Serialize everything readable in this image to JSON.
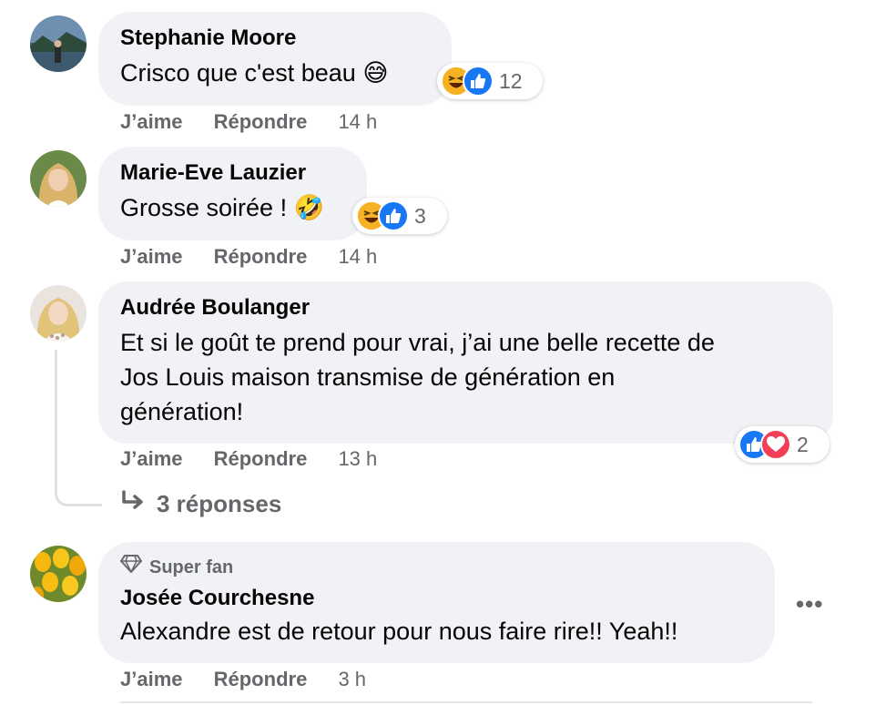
{
  "comments": [
    {
      "author": "Stephanie Moore",
      "text": "Crisco que c'est beau",
      "emoji": "😅",
      "like_label": "J’aime",
      "reply_label": "Répondre",
      "time": "14 h",
      "reactions": [
        "laugh",
        "like"
      ],
      "reaction_count": "12"
    },
    {
      "author": "Marie-Eve Lauzier",
      "text": "Grosse soirée !",
      "emoji": "🤣",
      "like_label": "J’aime",
      "reply_label": "Répondre",
      "time": "14 h",
      "reactions": [
        "laugh",
        "like"
      ],
      "reaction_count": "3"
    },
    {
      "author": "Audrée Boulanger",
      "text_lines": [
        "Et si le goût te prend pour vrai, j’ai une belle recette de",
        "Jos Louis maison transmise de génération en",
        "génération!"
      ],
      "like_label": "J’aime",
      "reply_label": "Répondre",
      "time": "13 h",
      "reactions": [
        "like",
        "love"
      ],
      "reaction_count": "2",
      "replies_label": "3 réponses"
    },
    {
      "badge": "Super fan",
      "author": "Josée Courchesne",
      "text": "Alexandre est de retour pour nous faire rire!! Yeah!!",
      "like_label": "J’aime",
      "reply_label": "Répondre",
      "time": "3 h",
      "more_label": "•••"
    }
  ],
  "colors": {
    "bubble": "#f0f2f5",
    "like_blue": "#1877f2",
    "love_red": "#f33e58",
    "laugh_yellow": "#f7b125",
    "secondary_text": "#65676b"
  },
  "icons": [
    "like-icon",
    "love-icon",
    "laugh-icon",
    "reply-arrow-icon",
    "diamond-icon",
    "more-icon"
  ]
}
